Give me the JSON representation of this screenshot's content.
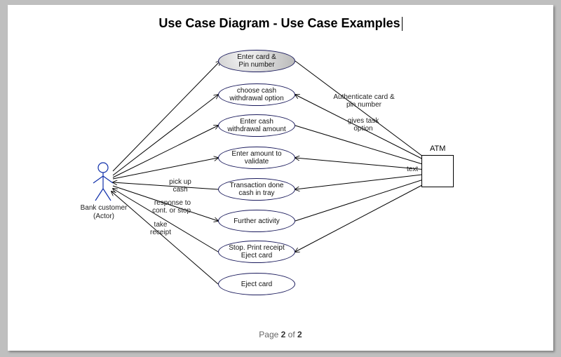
{
  "title": "Use Case Diagram - Use Case Examples",
  "actors": {
    "customer": {
      "label": "Bank customer\n(Actor)"
    },
    "atm": {
      "label": "ATM",
      "text": "text"
    }
  },
  "usecases": {
    "enterCard": "Enter card &\nPin number",
    "chooseWithdraw": "choose cash\nwithdrawal option",
    "enterWithdrawAmt": "Enter cash\nwithdrawal amount",
    "enterAmtValidate": "Enter amount to\nvalidate",
    "transactionDone": "Transaction done\ncash in tray",
    "furtherActivity": "Further activity",
    "stopPrint": "Stop. Print receipt\nEject card",
    "ejectCard": "Eject card"
  },
  "edgeLabels": {
    "authenticate": "Authenticate card &\npin number",
    "givesTask": "gives task\noption",
    "pickupCash": "pick up\ncash",
    "responseCont": "response to\ncont. or stop.",
    "takeReceipt": "take\nreceipt"
  },
  "footer": {
    "prefix": "Page ",
    "current": "2",
    "of": " of ",
    "total": "2"
  }
}
